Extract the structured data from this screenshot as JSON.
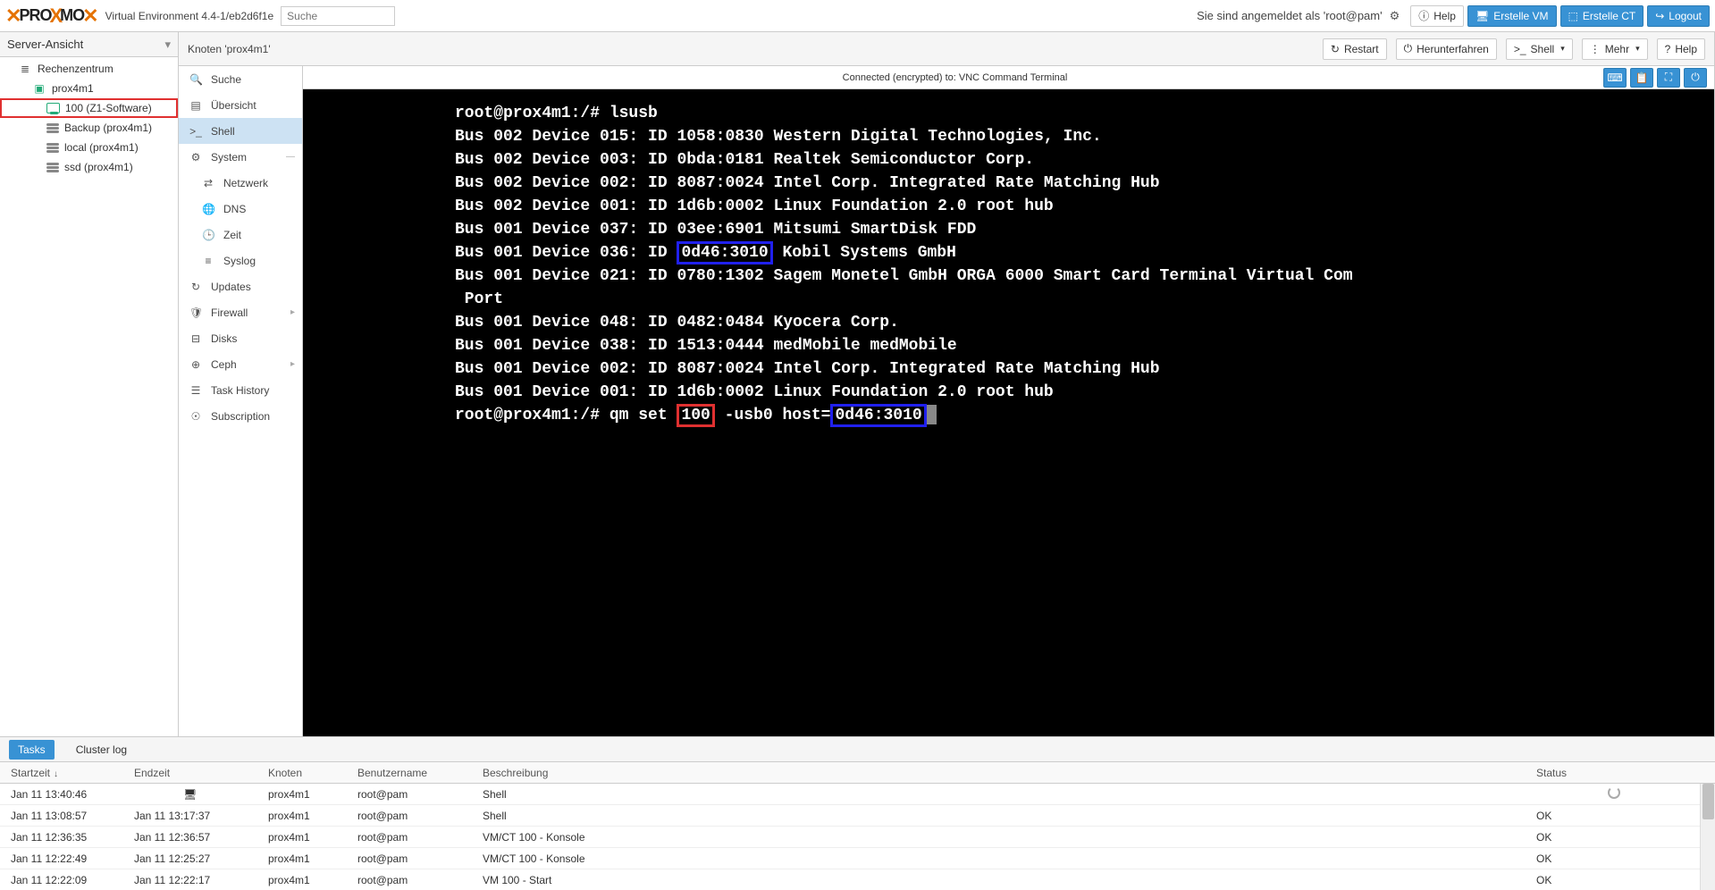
{
  "header": {
    "logo_pro": "PRO",
    "logo_x": "X",
    "logo_mo": "MO",
    "env": "Virtual Environment 4.4-1/eb2d6f1e",
    "search_placeholder": "Suche",
    "login_msg": "Sie sind angemeldet als 'root@pam'",
    "help_top": "Help",
    "create_vm": "Erstelle VM",
    "create_ct": "Erstelle CT",
    "logout": "Logout"
  },
  "sidebar": {
    "view": "Server-Ansicht",
    "nodes": {
      "dc": "Rechenzentrum",
      "node": "prox4m1",
      "vm100": "100 (Z1-Software)",
      "backup": "Backup (prox4m1)",
      "local": "local (prox4m1)",
      "ssd": "ssd (prox4m1)"
    }
  },
  "content": {
    "title": "Knoten 'prox4m1'",
    "restart": "Restart",
    "shutdown": "Herunterfahren",
    "shell": "Shell",
    "more": "Mehr",
    "help": "Help"
  },
  "sidemenu": {
    "search": "Suche",
    "summary": "Übersicht",
    "shell": "Shell",
    "system": "System",
    "network": "Netzwerk",
    "dns": "DNS",
    "time": "Zeit",
    "syslog": "Syslog",
    "updates": "Updates",
    "firewall": "Firewall",
    "disks": "Disks",
    "ceph": "Ceph",
    "taskhist": "Task History",
    "subscription": "Subscription"
  },
  "conn": {
    "msg": "Connected (encrypted) to: VNC Command Terminal"
  },
  "terminal": [
    {
      "t": "plain",
      "v": "root@prox4m1:/# lsusb"
    },
    {
      "t": "plain",
      "v": "Bus 002 Device 015: ID 1058:0830 Western Digital Technologies, Inc."
    },
    {
      "t": "plain",
      "v": "Bus 002 Device 003: ID 0bda:0181 Realtek Semiconductor Corp."
    },
    {
      "t": "plain",
      "v": "Bus 002 Device 002: ID 8087:0024 Intel Corp. Integrated Rate Matching Hub"
    },
    {
      "t": "plain",
      "v": "Bus 002 Device 001: ID 1d6b:0002 Linux Foundation 2.0 root hub"
    },
    {
      "t": "plain",
      "v": "Bus 001 Device 037: ID 03ee:6901 Mitsumi SmartDisk FDD"
    },
    {
      "t": "b1",
      "pre": "Bus 001 Device 036: ID ",
      "box": "0d46:3010",
      "post": " Kobil Systems GmbH"
    },
    {
      "t": "plain",
      "v": "Bus 001 Device 021: ID 0780:1302 Sagem Monetel GmbH ORGA 6000 Smart Card Terminal Virtual Com"
    },
    {
      "t": "plain",
      "v": " Port"
    },
    {
      "t": "plain",
      "v": "Bus 001 Device 048: ID 0482:0484 Kyocera Corp."
    },
    {
      "t": "plain",
      "v": "Bus 001 Device 038: ID 1513:0444 medMobile medMobile"
    },
    {
      "t": "plain",
      "v": "Bus 001 Device 002: ID 8087:0024 Intel Corp. Integrated Rate Matching Hub"
    },
    {
      "t": "plain",
      "v": "Bus 001 Device 001: ID 1d6b:0002 Linux Foundation 2.0 root hub"
    },
    {
      "t": "cmd",
      "pre": "root@prox4m1:/# qm set ",
      "red": "100",
      "mid": " -usb0 host=",
      "blue": "0d46:3010"
    }
  ],
  "bottom": {
    "tab_tasks": "Tasks",
    "tab_cluster": "Cluster log",
    "head": {
      "start": "Startzeit",
      "end": "Endzeit",
      "node": "Knoten",
      "user": "Benutzername",
      "desc": "Beschreibung",
      "status": "Status"
    },
    "rows": [
      {
        "s": "Jan 11 13:40:46",
        "e": "",
        "eicon": true,
        "n": "prox4m1",
        "u": "root@pam",
        "d": "Shell",
        "st": "",
        "spin": true
      },
      {
        "s": "Jan 11 13:08:57",
        "e": "Jan 11 13:17:37",
        "n": "prox4m1",
        "u": "root@pam",
        "d": "Shell",
        "st": "OK"
      },
      {
        "s": "Jan 11 12:36:35",
        "e": "Jan 11 12:36:57",
        "n": "prox4m1",
        "u": "root@pam",
        "d": "VM/CT 100 - Konsole",
        "st": "OK"
      },
      {
        "s": "Jan 11 12:22:49",
        "e": "Jan 11 12:25:27",
        "n": "prox4m1",
        "u": "root@pam",
        "d": "VM/CT 100 - Konsole",
        "st": "OK"
      },
      {
        "s": "Jan 11 12:22:09",
        "e": "Jan 11 12:22:17",
        "n": "prox4m1",
        "u": "root@pam",
        "d": "VM 100 - Start",
        "st": "OK"
      }
    ]
  }
}
